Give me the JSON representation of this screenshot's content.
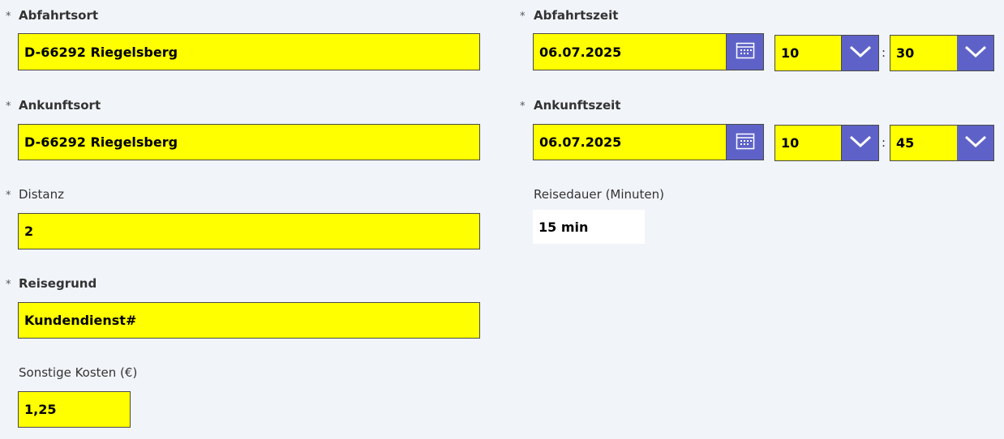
{
  "form": {
    "required_marker": "*",
    "departure_place": {
      "label": "Abfahrtsort",
      "value": "D-66292 Riegelsberg"
    },
    "arrival_place": {
      "label": "Ankunftsort",
      "value": "D-66292 Riegelsberg"
    },
    "distance": {
      "label": "Distanz",
      "value": "2"
    },
    "trip_reason": {
      "label": "Reisegrund",
      "value": "Kundendienst#"
    },
    "other_costs": {
      "label": "Sonstige Kosten (€)",
      "value": "1,25"
    },
    "departure_time": {
      "label": "Abfahrtszeit",
      "date": "06.07.2025",
      "hour": "10",
      "minute": "30"
    },
    "arrival_time": {
      "label": "Ankunftszeit",
      "date": "06.07.2025",
      "hour": "10",
      "minute": "45"
    },
    "duration": {
      "label": "Reisedauer (Minuten)",
      "value": "15 min"
    },
    "time_separator": ":"
  },
  "icons": {
    "calendar": "calendar-icon",
    "dropdown": "chevron-down-icon"
  },
  "colors": {
    "background": "#f1f4f9",
    "input_fill": "#ffff00",
    "button_fill": "#5e62c8",
    "text": "#333333"
  }
}
